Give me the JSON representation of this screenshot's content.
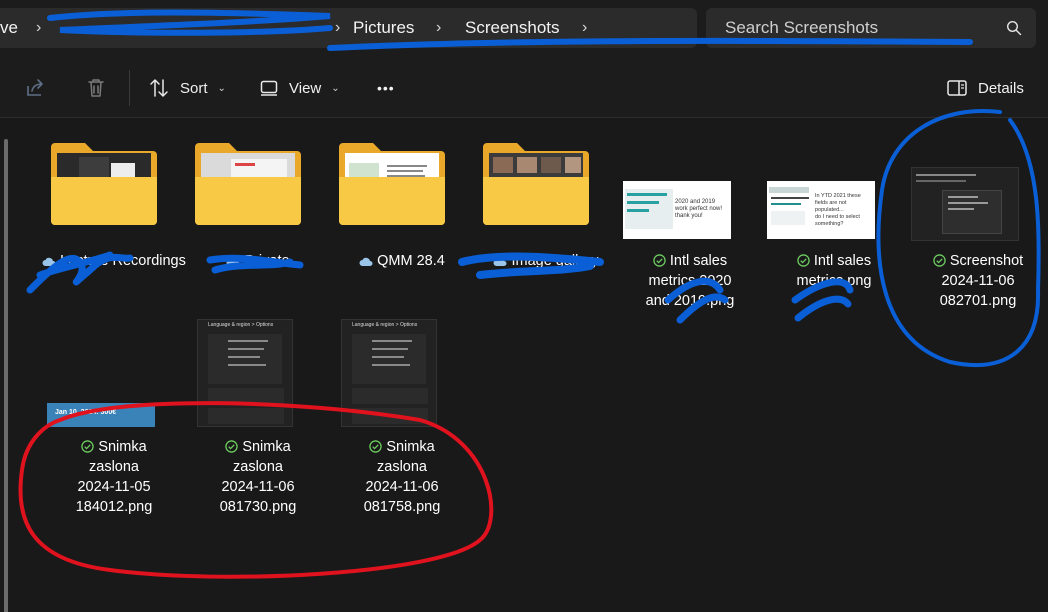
{
  "breadcrumb": {
    "partial_first": "ve",
    "items": [
      "Pictures",
      "Screenshots"
    ]
  },
  "search": {
    "placeholder": "Search Screenshots"
  },
  "toolbar": {
    "sort_label": "Sort",
    "view_label": "View",
    "more_label": "•••",
    "details_label": "Details"
  },
  "files": [
    {
      "name": "Lecture Recordings",
      "type": "folder",
      "status": "cloud"
    },
    {
      "name": "Private",
      "type": "folder",
      "status": "cloud"
    },
    {
      "name": "QMM 28.4",
      "type": "folder",
      "status": "cloud"
    },
    {
      "name": "Image gallery",
      "type": "folder",
      "status": "cloud"
    },
    {
      "name_lines": [
        "Intl sales",
        "metrics 2020",
        "and 2019.png"
      ],
      "type": "image",
      "status": "synced",
      "preview_lines": [
        "2020 and 2019",
        "work perfect now!",
        "thank you!"
      ]
    },
    {
      "name_lines": [
        "Intl sales",
        "metrics.png"
      ],
      "type": "image",
      "status": "synced",
      "preview_lines": [
        "In YTD 2021 these",
        "fields are not",
        "populated...",
        "do I need to select",
        "something?"
      ]
    },
    {
      "name_lines": [
        "Screenshot",
        "2024-11-06",
        "082701.png"
      ],
      "type": "image",
      "status": "synced"
    },
    {
      "name_lines": [
        "Snimka",
        "zaslona",
        "2024-11-05",
        "184012.png"
      ],
      "type": "image",
      "status": "synced",
      "preview_text": "Jan 10, 2024: 300€"
    },
    {
      "name_lines": [
        "Snimka",
        "zaslona",
        "2024-11-06",
        "081730.png"
      ],
      "type": "image",
      "status": "synced",
      "preview_title": "Language & region > Options"
    },
    {
      "name_lines": [
        "Snimka",
        "zaslona",
        "2024-11-06",
        "081758.png"
      ],
      "type": "image",
      "status": "synced",
      "preview_title": "Language & region > Options"
    }
  ],
  "folder_preview": {
    "qmm_title": "Ex TOOTHPASTE – Launch Plan"
  },
  "colors": {
    "folder": "#f8c945",
    "synced_green": "#6ccb5f",
    "cloud_blue": "#9bc5e8",
    "blue_scribble": "#0a5fd6",
    "red_scribble": "#e0121e"
  }
}
